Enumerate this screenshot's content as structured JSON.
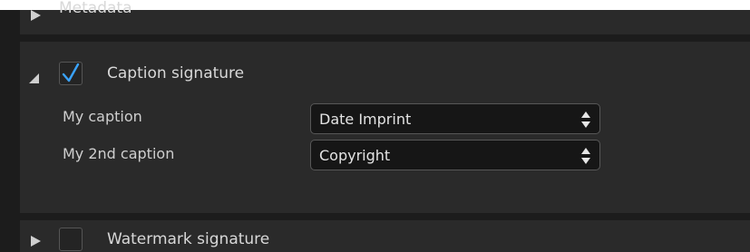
{
  "metadata": {
    "title": "Metadata"
  },
  "caption_signature": {
    "title": "Caption signature",
    "checked": true,
    "rows": [
      {
        "label": "My caption",
        "value": "Date Imprint"
      },
      {
        "label": "My 2nd caption",
        "value": "Copyright"
      }
    ]
  },
  "watermark_signature": {
    "title": "Watermark signature",
    "checked": false
  },
  "colors": {
    "checkmark": "#3aa3ff"
  },
  "icons": {
    "collapsed": "triangle-right-icon",
    "expanded": "triangle-down-icon",
    "check": "checkmark-icon",
    "spinner": "up-down-arrows-icon"
  }
}
